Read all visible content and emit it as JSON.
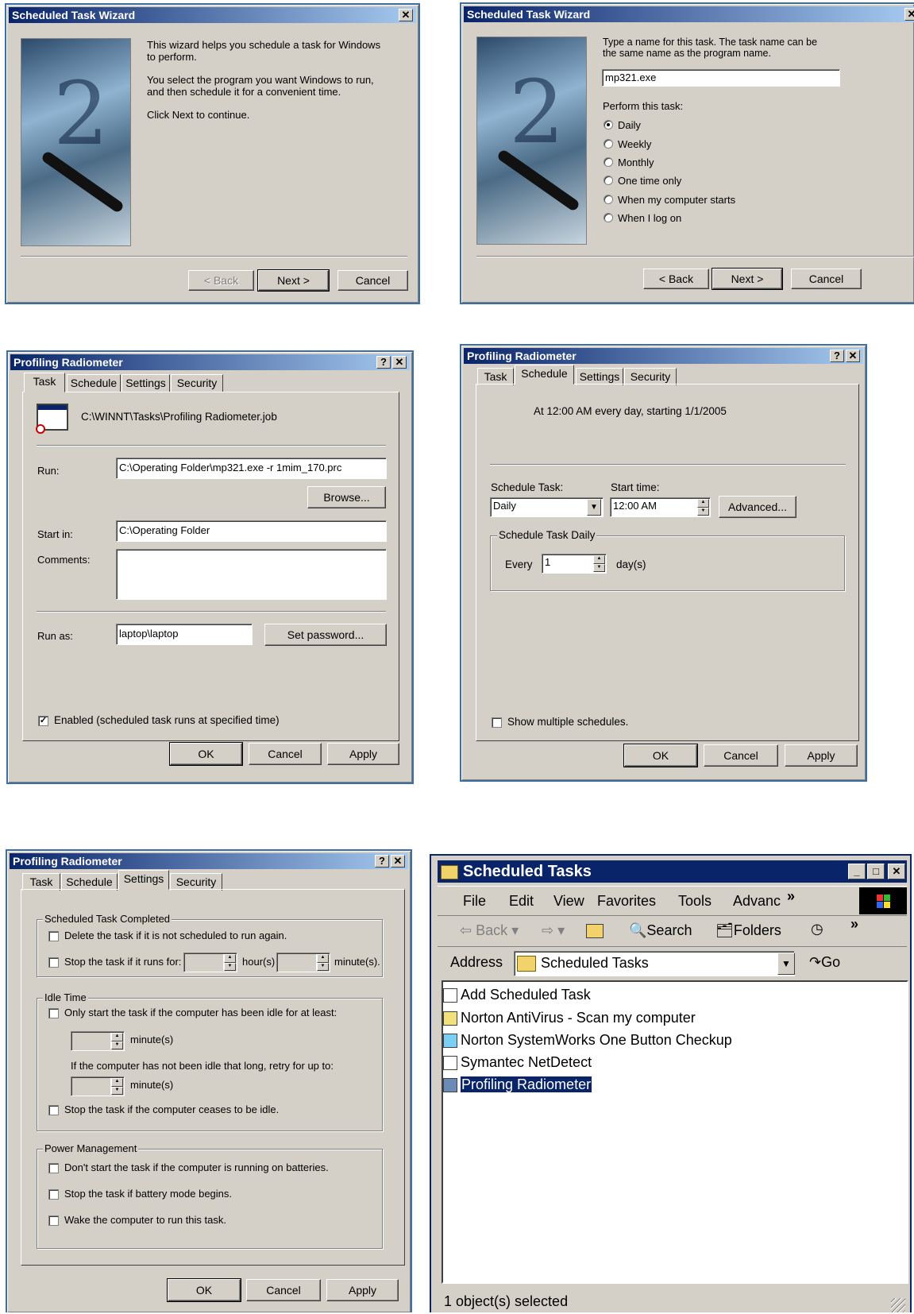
{
  "wizard1": {
    "title": "Scheduled Task Wizard",
    "close": "✕",
    "p1": "This wizard helps you schedule a task for Windows to perform.",
    "p2": "You select the program you want Windows to run, and then schedule it for a convenient time.",
    "p3": "Click Next to continue.",
    "back": "< Back",
    "next": "Next >",
    "cancel": "Cancel"
  },
  "wizard2": {
    "title": "Scheduled Task Wizard",
    "close": "✕",
    "prompt": "Type a name for this task.  The task name can be the same name as the program name.",
    "name_value": "mp321.exe",
    "perform_label": "Perform this task:",
    "options": [
      "Daily",
      "Weekly",
      "Monthly",
      "One time only",
      "When my computer starts",
      "When I log on"
    ],
    "selected_index": 0,
    "back": "< Back",
    "next": "Next >",
    "cancel": "Cancel"
  },
  "task_tab": {
    "title": "Profiling Radiometer",
    "help": "?",
    "close": "✕",
    "tabs": [
      "Task",
      "Schedule",
      "Settings",
      "Security"
    ],
    "job_path": "C:\\WINNT\\Tasks\\Profiling Radiometer.job",
    "run_label": "Run:",
    "run_value": "C:\\Operating Folder\\mp321.exe -r 1mim_170.prc",
    "browse": "Browse...",
    "startin_label": "Start in:",
    "startin_value": "C:\\Operating Folder",
    "comments_label": "Comments:",
    "comments_value": "",
    "runas_label": "Run as:",
    "runas_value": "laptop\\laptop",
    "set_password": "Set password...",
    "enabled_label": "Enabled (scheduled task runs at specified time)",
    "enabled_checked": true,
    "ok": "OK",
    "cancel": "Cancel",
    "apply": "Apply"
  },
  "schedule_tab": {
    "title": "Profiling Radiometer",
    "help": "?",
    "close": "✕",
    "tabs": [
      "Task",
      "Schedule",
      "Settings",
      "Security"
    ],
    "summary": "At 12:00 AM every day, starting 1/1/2005",
    "schedule_task_label": "Schedule Task:",
    "schedule_task_value": "Daily",
    "start_time_label": "Start time:",
    "start_time_value": "12:00 AM",
    "advanced": "Advanced...",
    "group_label": "Schedule Task Daily",
    "every_label": "Every",
    "every_value": "1",
    "days_label": "day(s)",
    "show_multiple": "Show multiple schedules.",
    "ok": "OK",
    "cancel": "Cancel",
    "apply": "Apply"
  },
  "settings_tab": {
    "title": "Profiling Radiometer",
    "help": "?",
    "close": "✕",
    "tabs": [
      "Task",
      "Schedule",
      "Settings",
      "Security"
    ],
    "completed_group": "Scheduled Task Completed",
    "delete_task": "Delete the task if it is not scheduled to run again.",
    "stop_task_runs": "Stop the task if it runs for:",
    "hours_label": "hour(s)",
    "minutes_label": "minute(s).",
    "idle_group": "Idle Time",
    "only_start_idle": "Only start the task if the computer has been idle for at least:",
    "idle_minutes": "minute(s)",
    "retry_label": "If the computer has not been idle that long, retry for up to:",
    "retry_minutes": "minute(s)",
    "stop_idle": "Stop the task if the computer ceases to be idle.",
    "power_group": "Power Management",
    "no_batteries": "Don't start the task if the computer is running on batteries.",
    "stop_battery": "Stop the task if battery mode begins.",
    "wake": "Wake the computer to run this task.",
    "ok": "OK",
    "cancel": "Cancel",
    "apply": "Apply"
  },
  "explorer": {
    "title": "Scheduled Tasks",
    "min": "_",
    "max": "□",
    "close": "✕",
    "menu": [
      "File",
      "Edit",
      "View",
      "Favorites",
      "Tools",
      "Advanc"
    ],
    "chevron": "»",
    "back": "Back",
    "search": "Search",
    "folders": "Folders",
    "address_label": "Address",
    "address_value": "Scheduled Tasks",
    "go": "Go",
    "items": [
      "Add Scheduled Task",
      "Norton AntiVirus - Scan my computer",
      "Norton SystemWorks One Button Checkup",
      "Symantec NetDetect",
      "Profiling Radiometer"
    ],
    "selected_index": 4,
    "status": "1 object(s) selected"
  }
}
